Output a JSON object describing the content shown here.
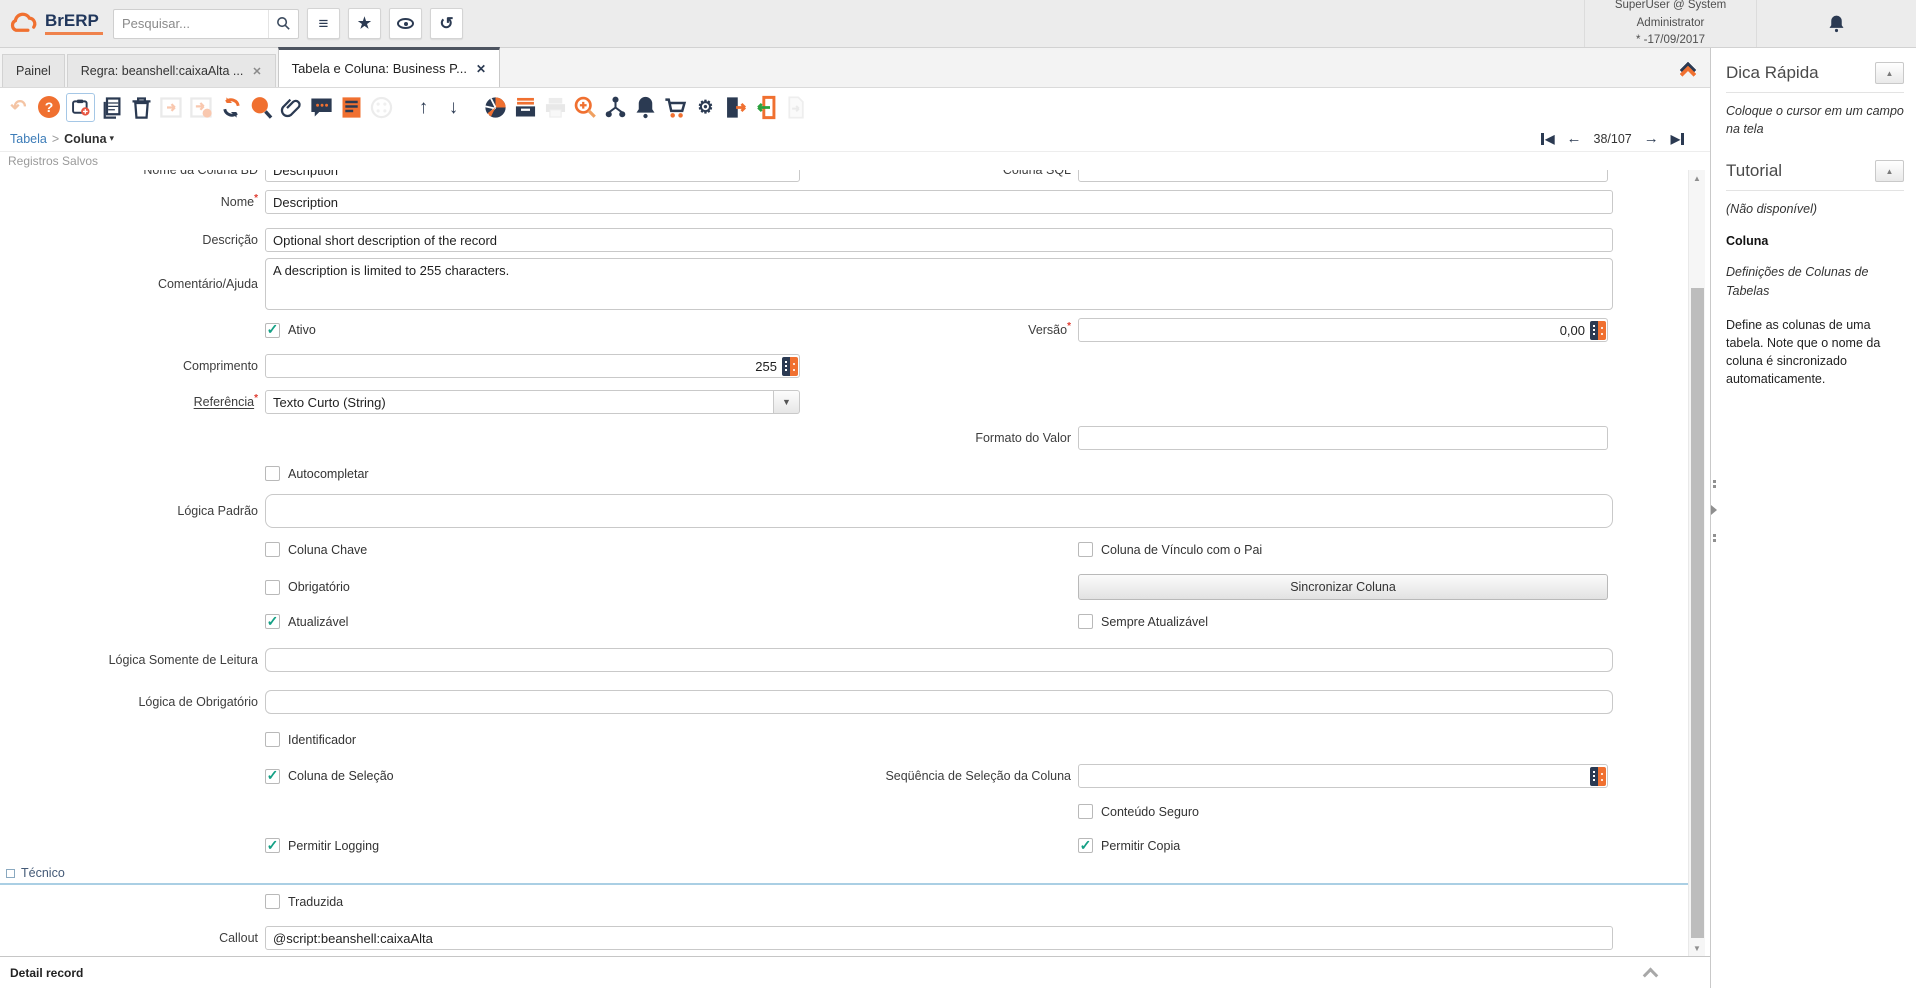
{
  "header": {
    "logo": "BrERP",
    "search_placeholder": "Pesquisar...",
    "user_line1": "SuperUser @ System Administrator",
    "user_line2": "* -17/09/2017"
  },
  "icons": {
    "menu": "≡",
    "star": "★",
    "history": "↺",
    "ignore": "↶",
    "help": "?",
    "up": "↑",
    "down": "↓",
    "gear": "⚙",
    "prev": "←",
    "next": "→",
    "first": "◀",
    "last": "▶",
    "combo": "▼",
    "caret": "▾",
    "close": "✕",
    "tri_up": "▲",
    "tri_down": "▼"
  },
  "tabs": [
    {
      "label": "Painel"
    },
    {
      "label": "Regra: beanshell:caixaAlta ..."
    },
    {
      "label": "Tabela e Coluna: Business P..."
    }
  ],
  "toolbar": {
    "buttons": [
      {
        "name": "ignore-changes",
        "disabled": true
      },
      {
        "name": "help"
      },
      {
        "name": "new-record",
        "selected": true
      },
      {
        "name": "copy-record"
      },
      {
        "name": "delete-record"
      },
      {
        "name": "delete-selection",
        "disabled": true
      },
      {
        "name": "save-create",
        "disabled": true
      },
      {
        "name": "requery"
      },
      {
        "name": "find"
      },
      {
        "name": "attachment"
      },
      {
        "name": "chat"
      },
      {
        "name": "log"
      },
      {
        "name": "customize",
        "disabled": true
      },
      {
        "name": "parent-record"
      },
      {
        "name": "detail-record"
      },
      {
        "name": "chart"
      },
      {
        "name": "archive"
      },
      {
        "name": "print",
        "disabled": true
      },
      {
        "name": "zoom-across"
      },
      {
        "name": "workflow"
      },
      {
        "name": "alert"
      },
      {
        "name": "request"
      },
      {
        "name": "process"
      },
      {
        "name": "export"
      },
      {
        "name": "end-window"
      },
      {
        "name": "csv-import",
        "disabled": true
      }
    ]
  },
  "breadcrumb": {
    "parent": "Tabela",
    "sep": ">",
    "current": "Coluna"
  },
  "record_nav": {
    "position": "38/107"
  },
  "saved_records": "Registros Salvos",
  "form": {
    "nome_coluna_bd": {
      "label": "Nome da Coluna BD",
      "value": "Description"
    },
    "coluna_sql": {
      "label": "Coluna SQL",
      "value": ""
    },
    "nome": {
      "label": "Nome",
      "req": "*",
      "value": "Description"
    },
    "descricao": {
      "label": "Descrição",
      "value": "Optional short description of the record"
    },
    "comentario": {
      "label": "Comentário/Ajuda",
      "value": "A description is limited to 255 characters."
    },
    "ativo": {
      "label": "Ativo",
      "check": "✓"
    },
    "versao": {
      "label": "Versão",
      "req": "*",
      "value": "0,00"
    },
    "comprimento": {
      "label": "Comprimento",
      "value": "255"
    },
    "referencia": {
      "label": "Referência",
      "req": "*",
      "value": "Texto Curto (String)"
    },
    "formato_valor": {
      "label": "Formato do Valor",
      "value": ""
    },
    "autocompletar": {
      "label": "Autocompletar",
      "check": ""
    },
    "logica_padrao": {
      "label": "Lógica Padrão",
      "value": ""
    },
    "coluna_chave": {
      "label": "Coluna Chave",
      "check": ""
    },
    "coluna_vinculo_pai": {
      "label": "Coluna de Vínculo com o Pai",
      "check": ""
    },
    "obrigatorio": {
      "label": "Obrigatório",
      "check": ""
    },
    "sincronizar": {
      "label": "Sincronizar Coluna"
    },
    "atualizavel": {
      "label": "Atualizável",
      "check": "✓"
    },
    "sempre_atualizavel": {
      "label": "Sempre Atualizável",
      "check": ""
    },
    "logica_somente_leitura": {
      "label": "Lógica Somente de Leitura",
      "value": ""
    },
    "logica_obrigatorio": {
      "label": "Lógica de Obrigatório",
      "value": ""
    },
    "identificador": {
      "label": "Identificador",
      "check": ""
    },
    "coluna_selecao": {
      "label": "Coluna de Seleção",
      "check": "✓"
    },
    "sequencia_selecao": {
      "label": "Seqüência de Seleção da Coluna",
      "value": ""
    },
    "conteudo_seguro": {
      "label": "Conteúdo Seguro",
      "check": ""
    },
    "permitir_logging": {
      "label": "Permitir Logging",
      "check": "✓"
    },
    "permitir_copia": {
      "label": "Permitir Copia",
      "check": "✓"
    },
    "tecnico": {
      "label": "Técnico"
    },
    "traduzida": {
      "label": "Traduzida",
      "check": ""
    },
    "callout": {
      "label": "Callout",
      "value": "@script:beanshell:caixaAlta"
    }
  },
  "statusbar": {
    "text": "Detail record"
  },
  "sidebar": {
    "quick_tip_title": "Dica Rápida",
    "quick_tip_body": "Coloque o cursor em um campo na tela",
    "tutorial_title": "Tutorial",
    "tutorial_unavailable": "(Não disponível)",
    "tutorial_topic": "Coluna",
    "tutorial_subtitle": "Definições de Colunas de Tabelas",
    "tutorial_body": "Define as colunas de uma tabela. Note que o nome da coluna é sincronizado automaticamente."
  },
  "colors": {
    "accent_orange": "#F07030",
    "navy": "#2B3A52",
    "check_green": "#14A085",
    "link_blue": "#3C7CB8",
    "required_red": "#E03C31",
    "group_line": "#AACFE4"
  }
}
